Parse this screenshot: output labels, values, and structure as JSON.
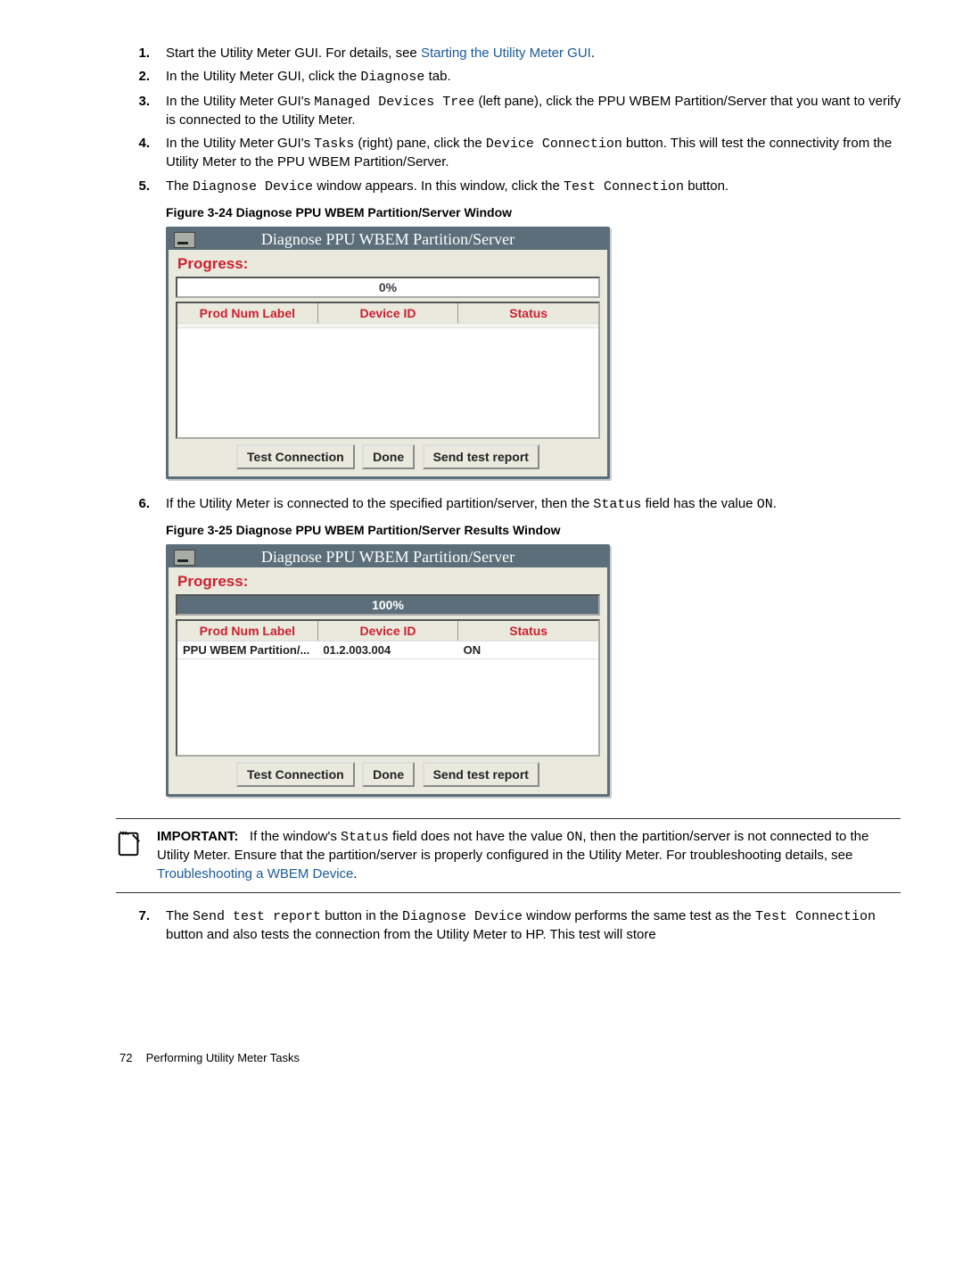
{
  "steps_a": [
    {
      "n": "1.",
      "pre": "Start the Utility Meter GUI. For details, see ",
      "link": "Starting the Utility Meter GUI",
      "post": "."
    },
    {
      "n": "2.",
      "pre": "In the Utility Meter GUI, click the ",
      "code": "Diagnose",
      "post": " tab."
    },
    {
      "n": "3.",
      "pre": "In the Utility Meter GUI's ",
      "code": "Managed Devices Tree",
      "post": " (left pane), click the PPU WBEM Partition/Server that you want to verify is connected to the Utility Meter."
    },
    {
      "n": "4.",
      "pre": "In the Utility Meter GUI's ",
      "code": "Tasks",
      "post": " (right) pane, click the ",
      "code2": "Device Connection",
      "post2": " button. This will test the connectivity from the Utility Meter to the PPU WBEM Partition/Server."
    },
    {
      "n": "5.",
      "pre": "The ",
      "code": "Diagnose Device",
      "post": " window appears. In this window, click the ",
      "code2": "Test Connection",
      "post2": " button."
    }
  ],
  "fig1_caption": "Figure 3-24 Diagnose PPU WBEM Partition/Server Window",
  "dialog": {
    "title": "Diagnose PPU WBEM Partition/Server",
    "progress_label": "Progress:",
    "columns": [
      "Prod Num Label",
      "Device ID",
      "Status"
    ],
    "buttons": [
      "Test Connection",
      "Done",
      "Send test report"
    ]
  },
  "fig1_progress": "0%",
  "step6": {
    "n": "6.",
    "pre": "If the Utility Meter is connected to the specified partition/server, then the ",
    "code": "Status",
    "post": " field has the value ",
    "code2": "ON",
    "post2": "."
  },
  "fig2_caption": "Figure 3-25 Diagnose PPU WBEM Partition/Server Results Window",
  "fig2_progress": "100%",
  "fig2_row": {
    "prod": "PPU WBEM Partition/...",
    "dev": "01.2.003.004",
    "status": "ON"
  },
  "important": {
    "label": "IMPORTANT:",
    "pre": "If the window's ",
    "code1": "Status",
    "mid1": " field does not have the value ",
    "code2": "ON",
    "mid2": ", then the partition/server is not connected to the Utility Meter. Ensure that the partition/server is properly configured in the Utility Meter. For troubleshooting details, see ",
    "link": "Troubleshooting a WBEM Device",
    "post": "."
  },
  "step7": {
    "n": "7.",
    "pre": "The ",
    "code": "Send test report",
    "mid1": " button in the ",
    "code2": "Diagnose Device",
    "mid2": " window performs the same test as the ",
    "code3": "Test Connection",
    "post": " button and also tests the connection from the Utility Meter to HP. This test will store"
  },
  "footer": {
    "page": "72",
    "title": "Performing Utility Meter Tasks"
  }
}
